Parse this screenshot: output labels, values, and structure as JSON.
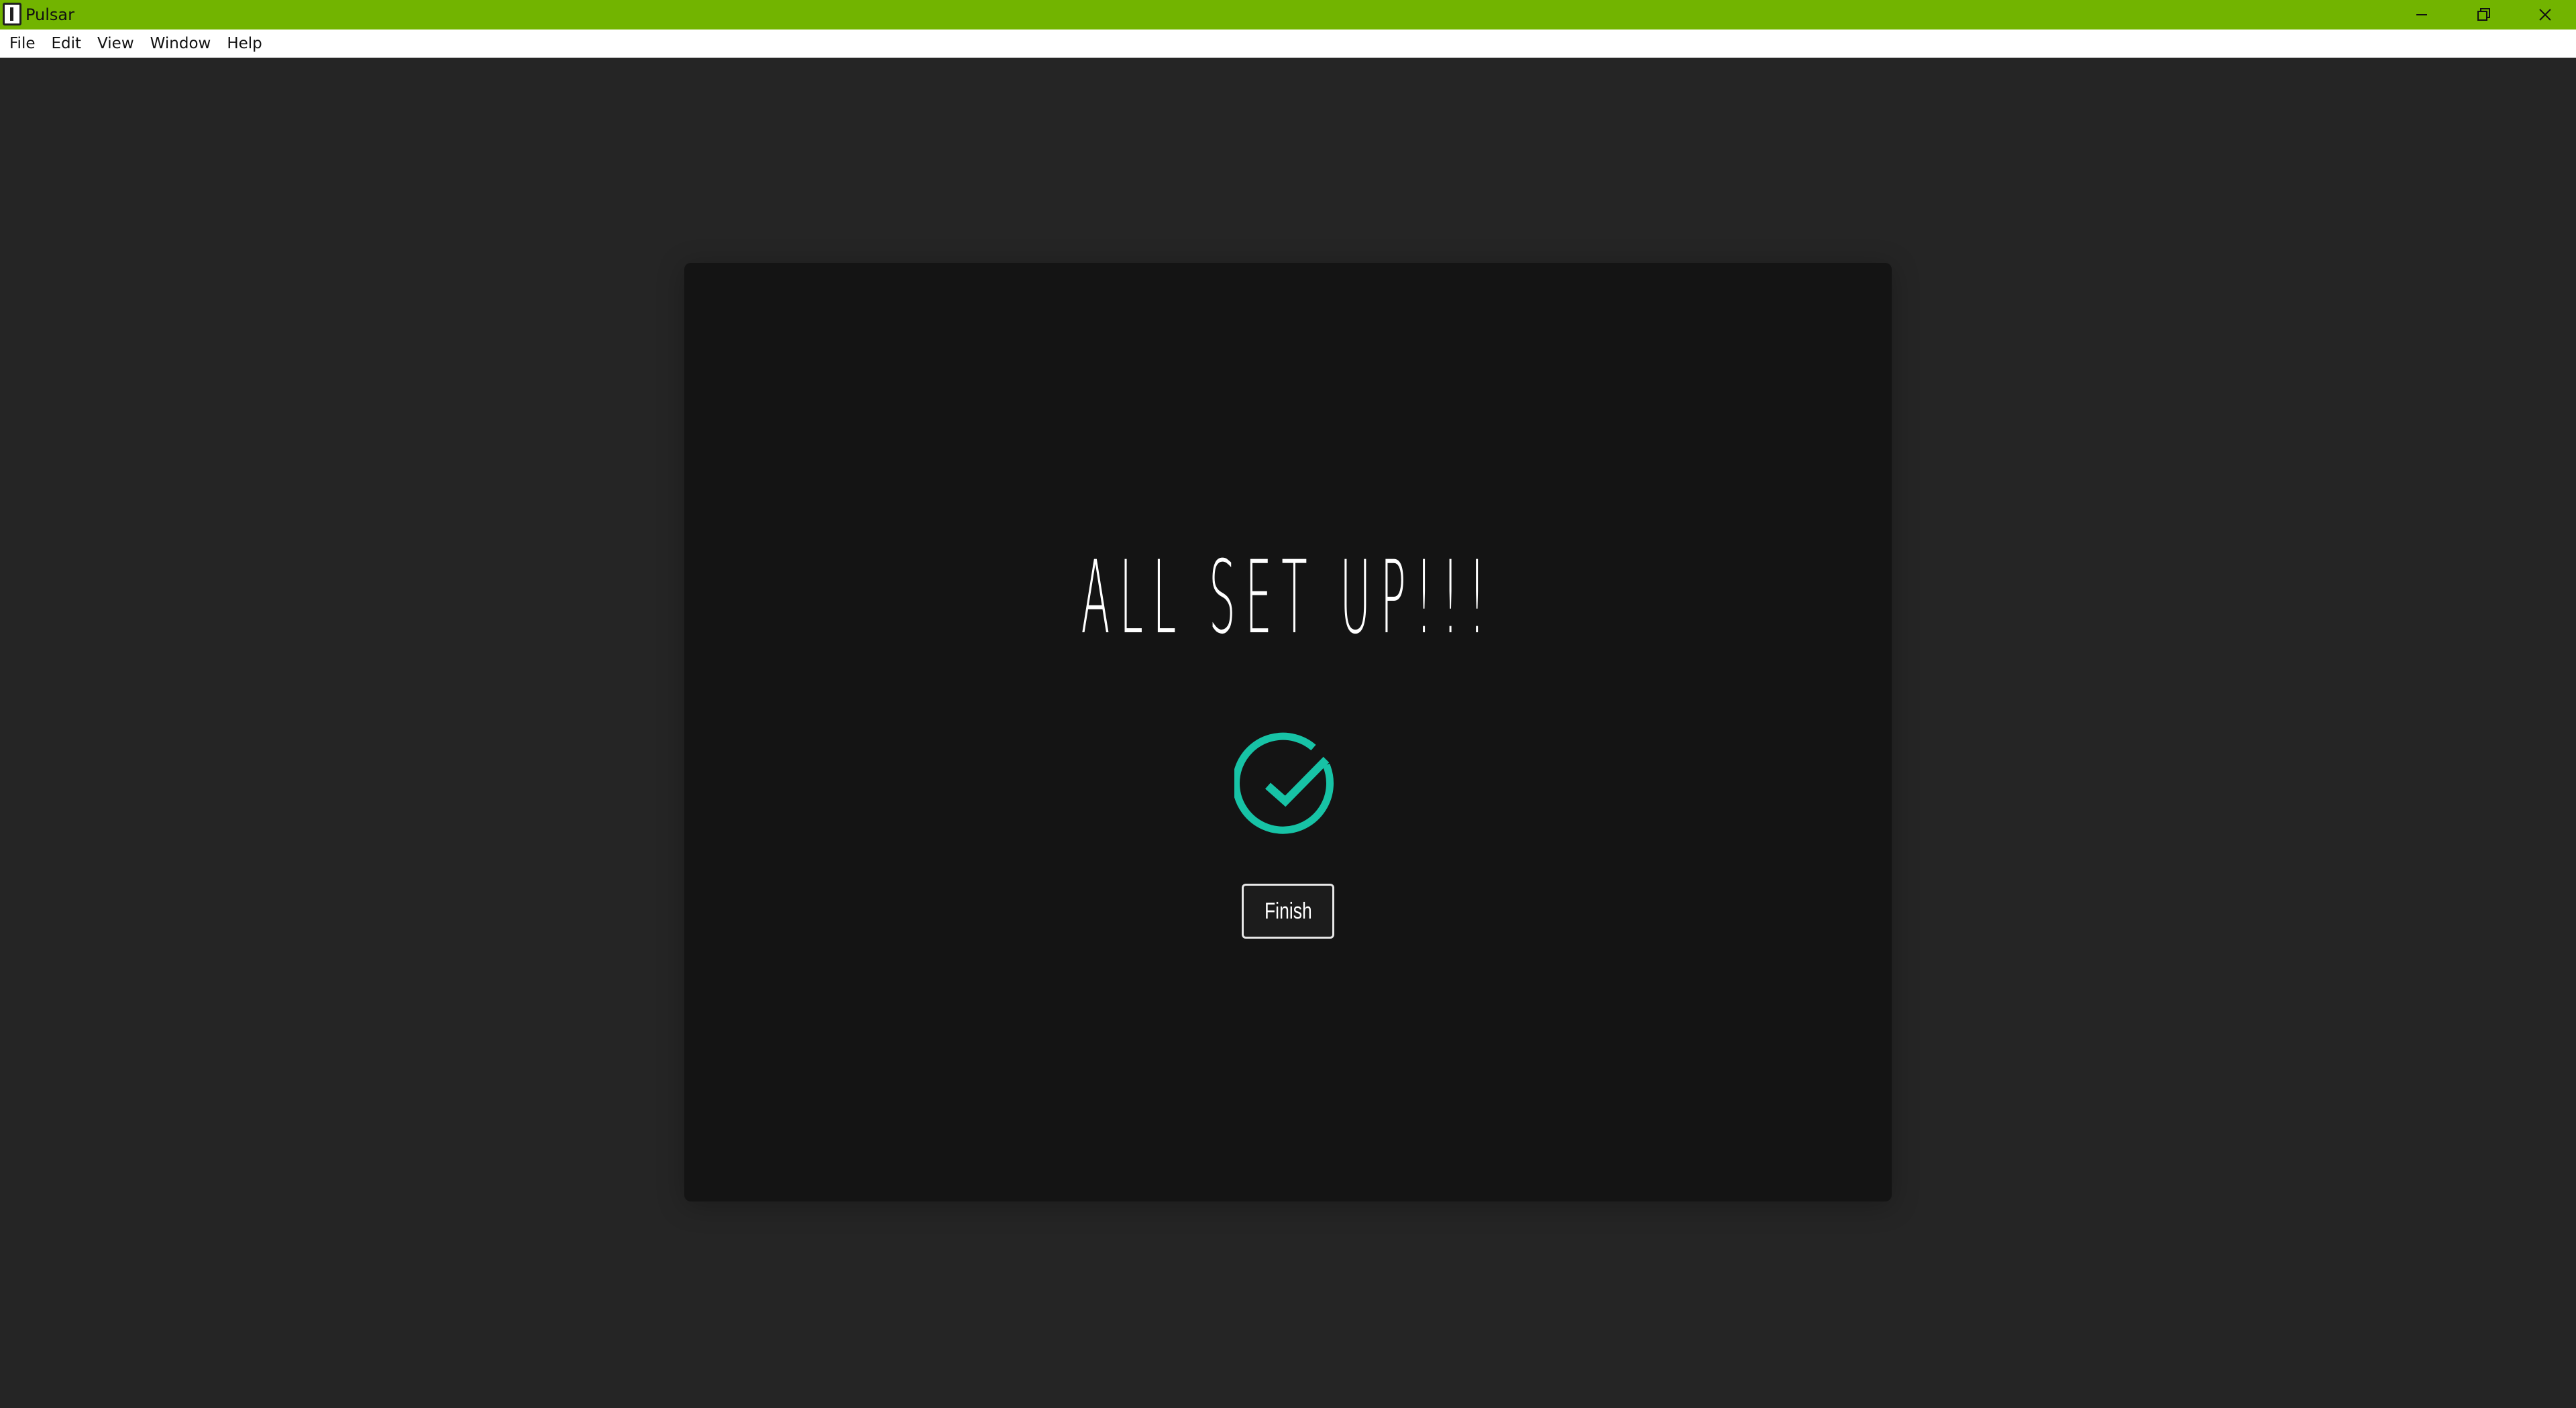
{
  "window": {
    "title": "Pulsar",
    "icon": "pulsar-app-icon",
    "titlebar_color": "#72b400",
    "controls": [
      "minimize-icon",
      "restore-icon",
      "close-icon"
    ]
  },
  "menu": {
    "items": [
      "File",
      "Edit",
      "View",
      "Window",
      "Help"
    ]
  },
  "setup": {
    "headline": "ALL SET UP!!!",
    "icon": "check-circle-icon",
    "icon_color": "#17c3a6",
    "finish_label": "Finish"
  }
}
